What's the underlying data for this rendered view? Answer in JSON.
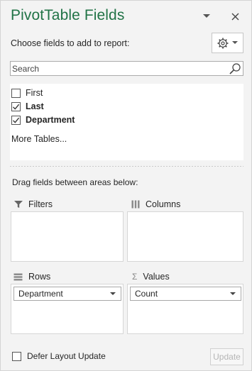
{
  "pane": {
    "title": "PivotTable Fields",
    "subtitle": "Choose fields to add to report:",
    "accent_color": "#217346"
  },
  "header_icons": {
    "dropdown": "chevron-down-icon",
    "close": "close-icon",
    "tools": "gear-icon"
  },
  "search": {
    "placeholder": "Search",
    "value": ""
  },
  "fields": [
    {
      "label": "First",
      "checked": false
    },
    {
      "label": "Last",
      "checked": true
    },
    {
      "label": "Department",
      "checked": true
    }
  ],
  "more_tables_label": "More Tables...",
  "drag_label": "Drag fields between areas below:",
  "areas": {
    "filters": {
      "label": "Filters",
      "icon": "filter-icon"
    },
    "columns": {
      "label": "Columns",
      "icon": "columns-icon"
    },
    "rows": {
      "label": "Rows",
      "icon": "rows-icon",
      "field": "Department"
    },
    "values": {
      "label": "Values",
      "icon": "sigma-icon",
      "field": "Count"
    }
  },
  "footer": {
    "defer_label": "Defer Layout Update",
    "defer_checked": false,
    "update_label": "Update"
  }
}
